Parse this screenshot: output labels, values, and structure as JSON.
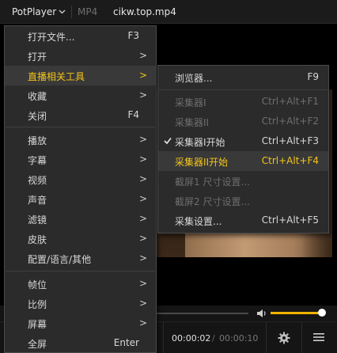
{
  "titlebar": {
    "app_name": "PotPlayer",
    "format": "MP4",
    "filename": "cikw.top.mp4"
  },
  "controls": {
    "time_current": "00:00:02",
    "time_divider": "/",
    "time_total": "00:00:10",
    "volume_level": 0.9,
    "accent_color": "#f0b400"
  },
  "main_menu": [
    {
      "label": "打开文件...",
      "shortcut": "F3",
      "submenu": false
    },
    {
      "label": "打开",
      "shortcut": "",
      "submenu": true
    },
    {
      "label": "直播相关工具",
      "shortcut": "",
      "submenu": true,
      "highlighted": true
    },
    {
      "label": "收藏",
      "shortcut": "",
      "submenu": true
    },
    {
      "label": "关闭",
      "shortcut": "F4",
      "submenu": false
    },
    {
      "label": "播放",
      "shortcut": "",
      "submenu": true
    },
    {
      "label": "字幕",
      "shortcut": "",
      "submenu": true
    },
    {
      "label": "视频",
      "shortcut": "",
      "submenu": true
    },
    {
      "label": "声音",
      "shortcut": "",
      "submenu": true
    },
    {
      "label": "滤镜",
      "shortcut": "",
      "submenu": true
    },
    {
      "label": "皮肤",
      "shortcut": "",
      "submenu": true
    },
    {
      "label": "配置/语言/其他",
      "shortcut": "",
      "submenu": true
    },
    {
      "label": "帧位",
      "shortcut": "",
      "submenu": true
    },
    {
      "label": "比例",
      "shortcut": "",
      "submenu": true
    },
    {
      "label": "屏幕",
      "shortcut": "",
      "submenu": true
    },
    {
      "label": "全屏",
      "shortcut": "Enter",
      "submenu": false
    }
  ],
  "sub_menu": [
    {
      "label": "浏览器...",
      "shortcut": "F9",
      "disabled": false
    },
    {
      "label": "采集器I",
      "shortcut": "Ctrl+Alt+F1",
      "disabled": true
    },
    {
      "label": "采集器II",
      "shortcut": "Ctrl+Alt+F2",
      "disabled": true
    },
    {
      "label": "采集器I开始",
      "shortcut": "Ctrl+Alt+F3",
      "checked": true
    },
    {
      "label": "采集器II开始",
      "shortcut": "Ctrl+Alt+F4",
      "highlighted": true
    },
    {
      "label": "截屏1 尺寸设置...",
      "shortcut": "",
      "disabled": true
    },
    {
      "label": "截屏2 尺寸设置...",
      "shortcut": "",
      "disabled": true
    },
    {
      "label": "采集设置...",
      "shortcut": "Ctrl+Alt+F5",
      "disabled": false
    }
  ],
  "icons": {
    "submenu_arrow": ">",
    "check": "check-icon",
    "gear": "gear-icon",
    "menu": "hamburger-icon",
    "volume": "speaker-icon"
  }
}
